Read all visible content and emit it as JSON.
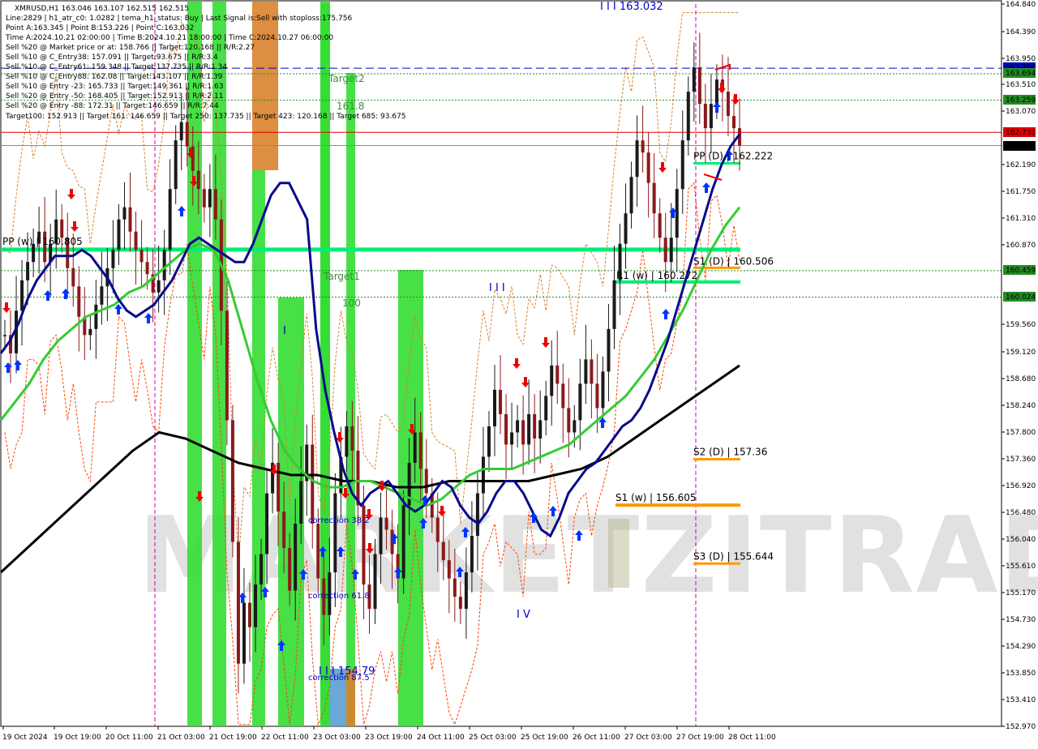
{
  "header": {
    "symbol_line": "XMRUSD,H1  163.046 163.107 162.515 162.515",
    "lines": [
      "Line:2829 | h1_atr_c0: 1.0282 | tema_h1_status: Buy | Last Signal is:Sell with stoploss:175.756",
      "Point A:163.345 | Point B:153.226 | Point C:163.032",
      "Time A:2024.10.21 02:00:00 | Time B:2024.10.21 18:00:00 | Time C:2024.10.27 06:00:00",
      "Sell %20 @ Market price or at: 158.766 || Target:120.168 || R/R:2.27",
      "Sell %10 @ C_Entry38: 157.091 || Target:93.675 || R/R:3.4",
      "Sell %10 @ C_Entry61: 159.348 || Target:137.735 || R/R:1.34",
      "Sell %10 @ C_Entry88: 162.08 || Target:143.107 || R/R:1.39",
      "Sell %10 @ Entry -23: 165.733 || Target:149.361 || R/R:1.63",
      "Sell %20 @ Entry -50: 168.405 || Target:152.913 || R/R:2.11",
      "Sell %20 @ Entry -88: 172.31 || Target:146.659 || R/R:7.44",
      "Target100: 152.913 || Target 161: 146.659 || Target 250: 137.735 || Target 423: 120.168 || Target 685: 93.675"
    ]
  },
  "watermark": "MARKETZITRADE",
  "colors": {
    "bull_body": "#1a1a1a",
    "bear_body": "#8b1a1a",
    "green_zone": "#33dd33",
    "orange_zone": "#d9822b",
    "blue_zone": "#5a9fd4",
    "navy_ma": "#0a0a8c",
    "green_ma": "#33cc33",
    "black_ma": "#000000",
    "pivot_green": "#00ee77",
    "support_orange": "#ff9900",
    "current_price_red": "#dd0000",
    "dashed_blue": "#0000cc",
    "dotted_green": "#228b22"
  },
  "chart_data": {
    "type": "candlestick",
    "symbol": "XMRUSD",
    "timeframe": "H1",
    "ylim": [
      152.97,
      164.84
    ],
    "y_ticks": [
      "164.840",
      "164.390",
      "163.950",
      "163.510",
      "163.070",
      "162.190",
      "161.750",
      "161.310",
      "160.870",
      "159.560",
      "159.120",
      "158.680",
      "158.240",
      "157.800",
      "157.360",
      "156.920",
      "156.480",
      "156.040",
      "155.610",
      "155.170",
      "154.730",
      "154.290",
      "153.850",
      "153.410",
      "152.970"
    ],
    "x_ticks": [
      "19 Oct 2024",
      "19 Oct 19:00",
      "20 Oct 11:00",
      "21 Oct 03:00",
      "21 Oct 19:00",
      "22 Oct 11:00",
      "23 Oct 03:00",
      "23 Oct 19:00",
      "24 Oct 11:00",
      "25 Oct 03:00",
      "25 Oct 19:00",
      "26 Oct 11:00",
      "27 Oct 03:00",
      "27 Oct 19:00",
      "28 Oct 11:00"
    ],
    "price_tags": [
      {
        "value": 163.786,
        "label": "163.786",
        "color": "#0000cc"
      },
      {
        "value": 163.694,
        "label": "163.694",
        "color": "#228b22"
      },
      {
        "value": 163.259,
        "label": "163.259",
        "color": "#228b22"
      },
      {
        "value": 162.731,
        "label": "162.731",
        "color": "#dd0000"
      },
      {
        "value": 162.515,
        "label": "162.515",
        "color": "#000000"
      },
      {
        "value": 160.459,
        "label": "160.459",
        "color": "#228b22"
      },
      {
        "value": 160.024,
        "label": "160.024",
        "color": "#228b22"
      }
    ],
    "levels": [
      {
        "name": "PP (w) | 160.805",
        "label": "PP (w) | 160.805",
        "value": 160.805
      },
      {
        "name": "PP (D) | 162.222",
        "label": "PP (D) | 162.222",
        "value": 162.222
      },
      {
        "name": "S1 (D) | 160.506",
        "label": "S1 (D) | 160.506",
        "value": 160.506
      },
      {
        "name": "R1 (w) | 160.272",
        "label": "R1 (w) | 160.272",
        "value": 160.272
      },
      {
        "name": "S2 (D) | 157.36",
        "label": "S2 (D) | 157.36",
        "value": 157.36
      },
      {
        "name": "S1 (w) | 156.605",
        "label": "S1 (w) | 156.605",
        "value": 156.605
      },
      {
        "name": "S3 (D) | 155.644",
        "label": "S3 (D) | 155.644",
        "value": 155.644
      }
    ],
    "annotations": [
      {
        "text": "I I I 163.032",
        "value": 164.84
      },
      {
        "text": "I I I 154.79",
        "value": 153.9
      },
      {
        "text": "Target2",
        "value": 163.45
      },
      {
        "text": "161.8",
        "value": 163.1
      },
      {
        "text": "Target1",
        "value": 160.35
      },
      {
        "text": "100",
        "value": 159.95
      },
      {
        "text": "I I I",
        "value": 160.1
      },
      {
        "text": "I",
        "value": 159.5
      },
      {
        "text": "I V",
        "value": 154.8
      },
      {
        "text": "correction 38.2",
        "value": 156.3
      },
      {
        "text": "correction 61.8",
        "value": 155.1
      },
      {
        "text": "correction 87.5",
        "value": 153.8
      }
    ],
    "closes": [
      159.4,
      159.1,
      159.8,
      160.3,
      160.6,
      160.9,
      161.1,
      160.6,
      160.9,
      161.3,
      161.0,
      160.5,
      160.2,
      159.7,
      159.4,
      159.5,
      159.9,
      160.2,
      160.5,
      160.8,
      161.3,
      161.5,
      161.1,
      160.8,
      160.6,
      160.4,
      160.1,
      160.3,
      160.8,
      161.8,
      162.6,
      162.9,
      162.5,
      162.1,
      161.8,
      161.5,
      161.8,
      161.3,
      159.8,
      158.0,
      156.0,
      154.0,
      155.0,
      154.6,
      155.3,
      155.8,
      156.8,
      157.3,
      156.5,
      155.9,
      155.2,
      156.3,
      157.0,
      157.6,
      156.3,
      155.4,
      154.8,
      155.5,
      156.8,
      157.4,
      157.9,
      157.5,
      156.6,
      155.3,
      154.9,
      155.8,
      156.4,
      156.2,
      155.8,
      155.4,
      156.6,
      157.3,
      157.8,
      157.2,
      156.8,
      156.4,
      156.0,
      155.7,
      155.4,
      155.1,
      154.9,
      155.5,
      156.1,
      156.8,
      157.4,
      157.9,
      158.5,
      158.1,
      157.6,
      157.8,
      158.0,
      157.6,
      158.1,
      157.7,
      158.0,
      158.4,
      158.9,
      158.6,
      158.2,
      157.8,
      158.0,
      158.6,
      159.0,
      158.6,
      158.2,
      158.8,
      159.5,
      160.3,
      160.9,
      161.4,
      162.0,
      162.6,
      162.4,
      161.9,
      161.4,
      161.0,
      160.6,
      161.0,
      161.8,
      162.6,
      163.4,
      163.8,
      163.2,
      162.8,
      163.2,
      163.6,
      163.4,
      163.0,
      162.8,
      162.515
    ],
    "ma_blue": [
      159.1,
      159.3,
      159.6,
      160.0,
      160.3,
      160.5,
      160.7,
      160.7,
      160.7,
      160.8,
      160.7,
      160.5,
      160.3,
      160.0,
      159.8,
      159.7,
      159.8,
      159.9,
      160.1,
      160.3,
      160.6,
      160.9,
      161.0,
      160.9,
      160.8,
      160.7,
      160.6,
      160.6,
      160.9,
      161.3,
      161.7,
      161.9,
      161.9,
      161.6,
      161.3,
      159.5,
      158.5,
      157.8,
      157.2,
      156.8,
      156.6,
      156.8,
      156.9,
      157.0,
      156.8,
      156.6,
      156.5,
      156.6,
      156.8,
      157.0,
      156.9,
      156.6,
      156.4,
      156.3,
      156.5,
      156.8,
      157.0,
      157.0,
      156.8,
      156.5,
      156.2,
      156.1,
      156.4,
      156.8,
      157.0,
      157.2,
      157.3,
      157.5,
      157.7,
      157.9,
      158.0,
      158.2,
      158.5,
      158.9,
      159.3,
      159.8,
      160.3,
      160.8,
      161.3,
      161.8,
      162.2,
      162.5,
      162.7
    ],
    "ma_green": [
      158.0,
      158.3,
      158.6,
      159.0,
      159.3,
      159.5,
      159.7,
      159.8,
      159.9,
      160.1,
      160.2,
      160.4,
      160.6,
      160.8,
      160.9,
      160.8,
      160.3,
      159.5,
      158.7,
      158.0,
      157.5,
      157.2,
      157.0,
      156.9,
      156.9,
      157.0,
      157.0,
      156.9,
      156.8,
      156.7,
      156.6,
      156.7,
      156.9,
      157.1,
      157.2,
      157.2,
      157.2,
      157.3,
      157.4,
      157.5,
      157.6,
      157.8,
      158.0,
      158.2,
      158.4,
      158.7,
      159.0,
      159.4,
      159.8,
      160.3,
      160.8,
      161.2,
      161.5
    ],
    "ma_black": [
      155.5,
      155.9,
      156.3,
      156.7,
      157.1,
      157.5,
      157.8,
      157.7,
      157.5,
      157.3,
      157.2,
      157.1,
      157.1,
      157.0,
      157.0,
      156.9,
      156.9,
      157.0,
      157.0,
      157.0,
      157.0,
      157.1,
      157.2,
      157.4,
      157.7,
      158.0,
      158.3,
      158.6,
      158.9
    ]
  }
}
